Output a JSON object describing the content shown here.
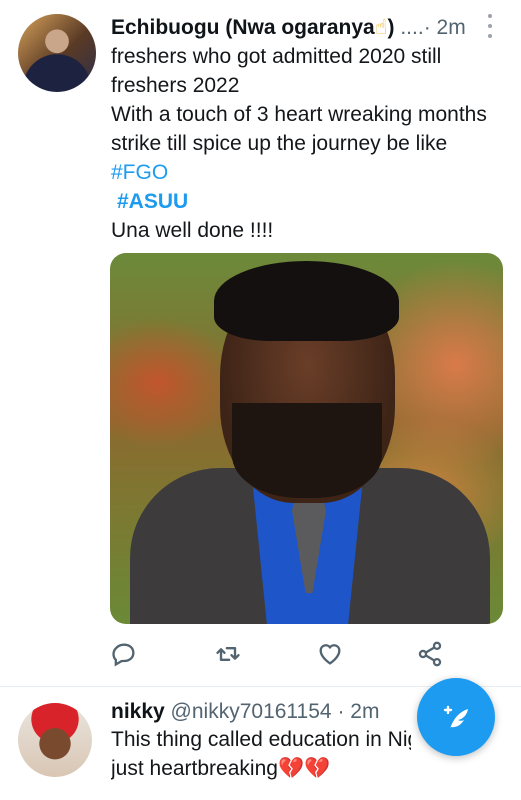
{
  "tweet1": {
    "name": "Echibuogu (Nwa ogaranya",
    "name_emoji": "☝",
    "name_close": ")",
    "handle_trunc": " ....",
    "time": "· 2m",
    "lines": [
      "freshers who got admitted 2020 still",
      "freshers 2022",
      "With a touch of 3 heart wreaking months",
      "strike till spice up the journey be like"
    ],
    "hashtags": [
      "#FGO",
      "#ASUU"
    ],
    "closing": "Una well done !!!!"
  },
  "actions": {
    "reply_icon": "reply-icon",
    "retweet_icon": "retweet-icon",
    "like_icon": "heart-icon",
    "share_icon": "share-icon"
  },
  "tweet2": {
    "name": "nikky",
    "handle": "@nikky70161154",
    "time": "· 2m",
    "line1": "This thing called education in Nig",
    "line2": "just heartbreaking",
    "emojis": "💔💔"
  },
  "fab": {
    "icon": "compose-feather-icon"
  },
  "colors": {
    "accent": "#1d9bf0",
    "text": "#14171a",
    "muted": "#536471"
  }
}
